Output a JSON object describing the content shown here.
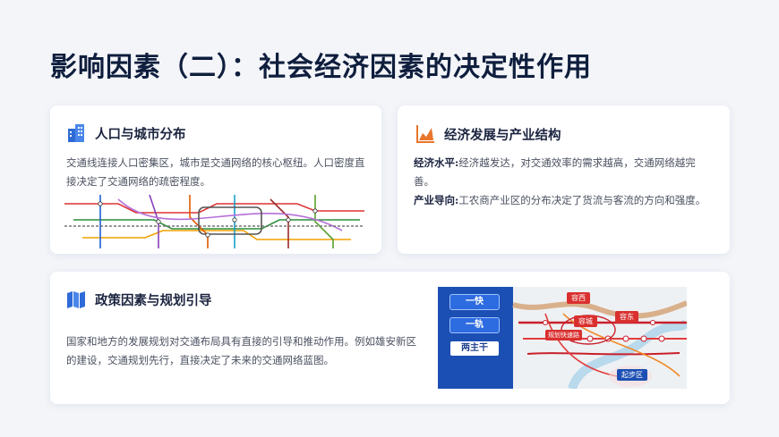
{
  "page": {
    "title": "影响因素（二）：社会经济因素的决定性作用"
  },
  "cards": [
    {
      "heading": "人口与城市分布",
      "icon": "building-icon",
      "text": "交通线连接人口密集区，城市是交通网络的核心枢纽。人口密度直接决定了交通网络的疏密程度。"
    },
    {
      "heading": "经济发展与产业结构",
      "icon": "growth-chart-icon",
      "items": [
        {
          "label": "经济水平:",
          "text": "经济越发达，对交通效率的需求越高，交通网络越完善。"
        },
        {
          "label": "产业导向:",
          "text": "工农商产业区的分布决定了货流与客流的方向和强度。"
        }
      ]
    },
    {
      "heading": "政策因素与规划引导",
      "icon": "map-icon",
      "text": "国家和地方的发展规划对交通布局具有直接的引导和推动作用。例如雄安新区的建设，交通规划先行，直接决定了未来的交通网络蓝图。",
      "map_buttons": [
        "一快",
        "一轨",
        "两主干"
      ],
      "map_labels": [
        "容西",
        "容城",
        "容东",
        "规划快速路",
        "起步区"
      ]
    }
  ],
  "colors": {
    "title": "#0f1e3d",
    "accent_blue": "#2f6bd8",
    "accent_orange": "#e8762c",
    "map_panel": "#1c4fb3"
  }
}
